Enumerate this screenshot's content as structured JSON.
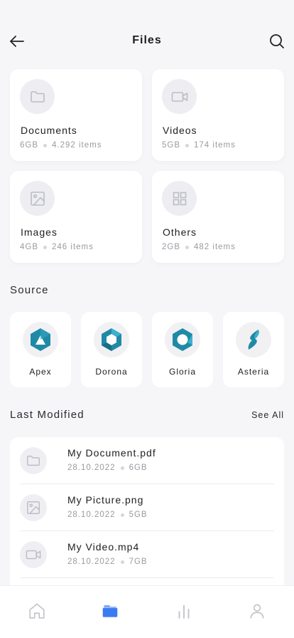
{
  "header": {
    "title": "Files",
    "back_icon": "arrow-left-icon",
    "search_icon": "search-icon"
  },
  "categories": [
    {
      "name": "Documents",
      "size": "6GB",
      "count": "4.292 items",
      "icon": "folder-icon"
    },
    {
      "name": "Videos",
      "size": "5GB",
      "count": "174 items",
      "icon": "video-camera-icon"
    },
    {
      "name": "Images",
      "size": "4GB",
      "count": "246 items",
      "icon": "image-icon"
    },
    {
      "name": "Others",
      "size": "2GB",
      "count": "482 items",
      "icon": "grid-icon"
    }
  ],
  "source": {
    "title": "Source",
    "items": [
      {
        "name": "Apex",
        "icon": "apex-logo-icon"
      },
      {
        "name": "Dorona",
        "icon": "dorona-logo-icon"
      },
      {
        "name": "Gloria",
        "icon": "gloria-logo-icon"
      },
      {
        "name": "Asteria",
        "icon": "asteria-logo-icon"
      }
    ]
  },
  "last_modified": {
    "title": "Last Modified",
    "see_all": "See All",
    "files": [
      {
        "name": "My Document.pdf",
        "date": "28.10.2022",
        "size": "6GB",
        "icon": "folder-icon"
      },
      {
        "name": "My Picture.png",
        "date": "28.10.2022",
        "size": "5GB",
        "icon": "image-icon"
      },
      {
        "name": "My Video.mp4",
        "date": "28.10.2022",
        "size": "7GB",
        "icon": "video-camera-icon"
      }
    ]
  },
  "tabbar": {
    "active": "files",
    "active_color": "#3a7bf2",
    "items": [
      "home-icon",
      "folder-icon",
      "bar-chart-icon",
      "user-icon"
    ]
  },
  "colors": {
    "background": "#f6f6f8",
    "accent": "#3a7bf2",
    "logo_teal": "#1f8aa6"
  }
}
